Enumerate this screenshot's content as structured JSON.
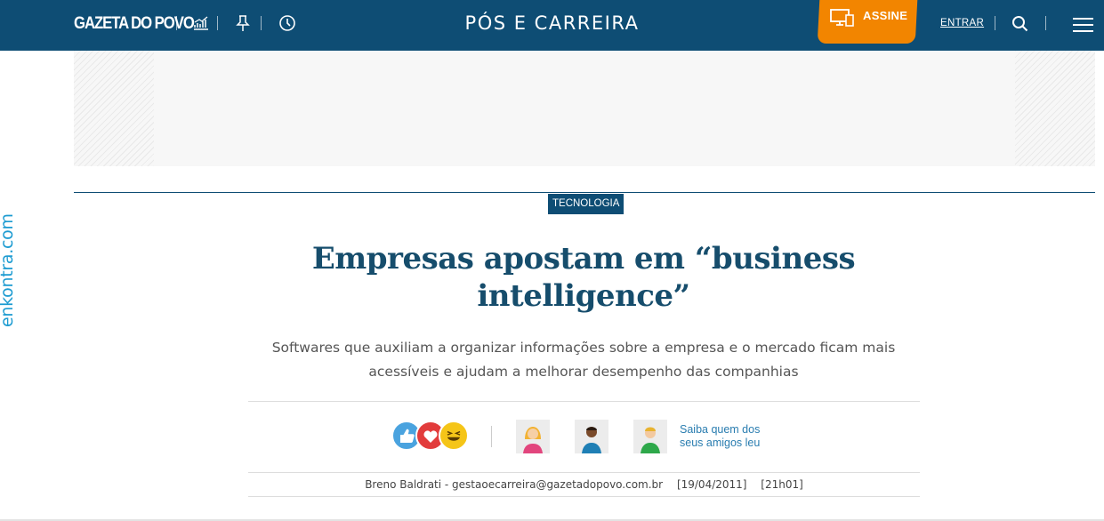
{
  "header": {
    "logo": "GAZETA DO POVO",
    "section_title": "PÓS E CARREIRA",
    "assine_label": "ASSINE",
    "entrar_label": "ENTRAR",
    "icons": [
      "chart-icon",
      "pin-icon",
      "clock-icon",
      "monitor-icon",
      "search-icon",
      "menu-icon"
    ],
    "bg_color": "#0e4d74",
    "accent_color": "#f28500"
  },
  "side_ad": {
    "brand": "enkontra.com"
  },
  "article": {
    "tag": "TECNOLOGIA",
    "headline": "Empresas apostam em “business intelligence”",
    "subtitle": "Softwares que auxiliam a organizar informações sobre a empresa e o mercado ficam mais acessíveis e ajudam a melhorar desempenho das companhias",
    "friends_link": "Saiba quem dos seus amigos leu",
    "author": "Breno Baldrati - gestaoecarreira@gazetadopovo.com.br",
    "date": "[19/04/2011]",
    "time": "[21h01]"
  }
}
